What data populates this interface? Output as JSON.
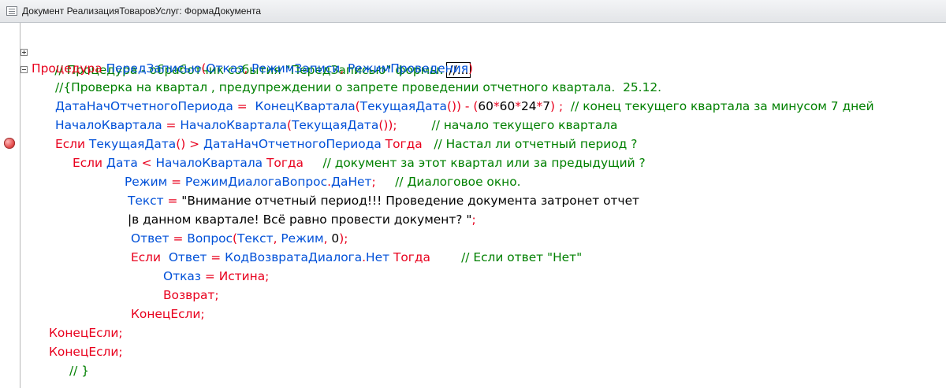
{
  "window": {
    "title": "Документ РеализацияТоваровУслуг: ФормаДокумента"
  },
  "code": {
    "l1": {
      "comment": "// Процедура - обработчик события \"ПередЗаписью\" формы.",
      "collapsed": "//..."
    },
    "l2": {
      "kw": "Процедура",
      "name": "ПередЗаписью",
      "p_open": "(",
      "a1": "Отказ",
      "c1": ", ",
      "a2": "РежимЗаписи",
      "c2": ", ",
      "a3": "РежимПроведения",
      "p_close": ")"
    },
    "l3": {
      "comment": "//{Проверка на квартал , предупреждении о запрете проведении отчетного квартала.  25.12."
    },
    "l4": {
      "var": "ДатаНачОтчетногоПериода",
      "eq": " = ",
      "f1": "КонецКвартала",
      "p1": "(",
      "f2": "ТекущаяДата",
      "p2": "()) ",
      "minus": "- ",
      "p3": "(",
      "n1": "60",
      "m1": "*",
      "n2": "60",
      "m2": "*",
      "n3": "24",
      "m3": "*",
      "n4": "7",
      "p4": ") ;",
      "comment": "  // конец текущего квартала за минусом 7 дней"
    },
    "l5": {
      "var": "НачалоКвартала",
      "eq": " = ",
      "f1": "НачалоКвартала",
      "p1": "(",
      "f2": "ТекущаяДата",
      "p2": "());",
      "comment": "         // начало текущего квартала"
    },
    "l6": {
      "kw1": "Если ",
      "f1": "ТекущаяДата",
      "p1": "() ",
      "gt": "> ",
      "var": "ДатаНачОтчетногоПериода",
      "kw2": " Тогда",
      "comment": "   // Настал ли отчетный период ?"
    },
    "l7": {
      "kw1": "Если ",
      "var1": "Дата",
      "lt": " < ",
      "var2": "НачалоКвартала",
      "kw2": " Тогда",
      "comment": "     // документ за этот квартал или за предыдущий ?"
    },
    "l8": {
      "var": "Режим",
      "eq": " = ",
      "obj": "РежимДиалогаВопрос",
      "dot": ".",
      "prop": "ДаНет",
      "semi": ";",
      "comment": "     // Диалоговое окно."
    },
    "l9": {
      "var": "Текст",
      "eq": " = ",
      "str": "\"Внимание отчетный период!!! Проведение документа затронет отчет"
    },
    "l10": {
      "str": "|в данном квартале! Всё равно провести документ? \"",
      "semi": ";"
    },
    "l11": {
      "var": "Ответ",
      "eq": " = ",
      "f": "Вопрос",
      "p1": "(",
      "a1": "Текст",
      "c1": ", ",
      "a2": "Режим",
      "c2": ", ",
      "n": "0",
      "p2": ");"
    },
    "l12": {
      "kw1": "Если  ",
      "var": "Ответ",
      "eq": " = ",
      "obj": "КодВозвратаДиалога",
      "dot": ".",
      "prop": "Нет",
      "kw2": " Тогда",
      "comment": "        // Если ответ \"Нет\""
    },
    "l13": {
      "var": "Отказ",
      "eq": " = ",
      "val": "Истина",
      "semi": ";"
    },
    "l14": {
      "kw": "Возврат",
      "semi": ";"
    },
    "l15": {
      "kw": "КонецЕсли",
      "semi": ";"
    },
    "l16": {
      "kw": "КонецЕсли",
      "semi": ";"
    },
    "l17": {
      "kw": "КонецЕсли",
      "semi": ";"
    },
    "l18": {
      "comment": "// }"
    }
  }
}
